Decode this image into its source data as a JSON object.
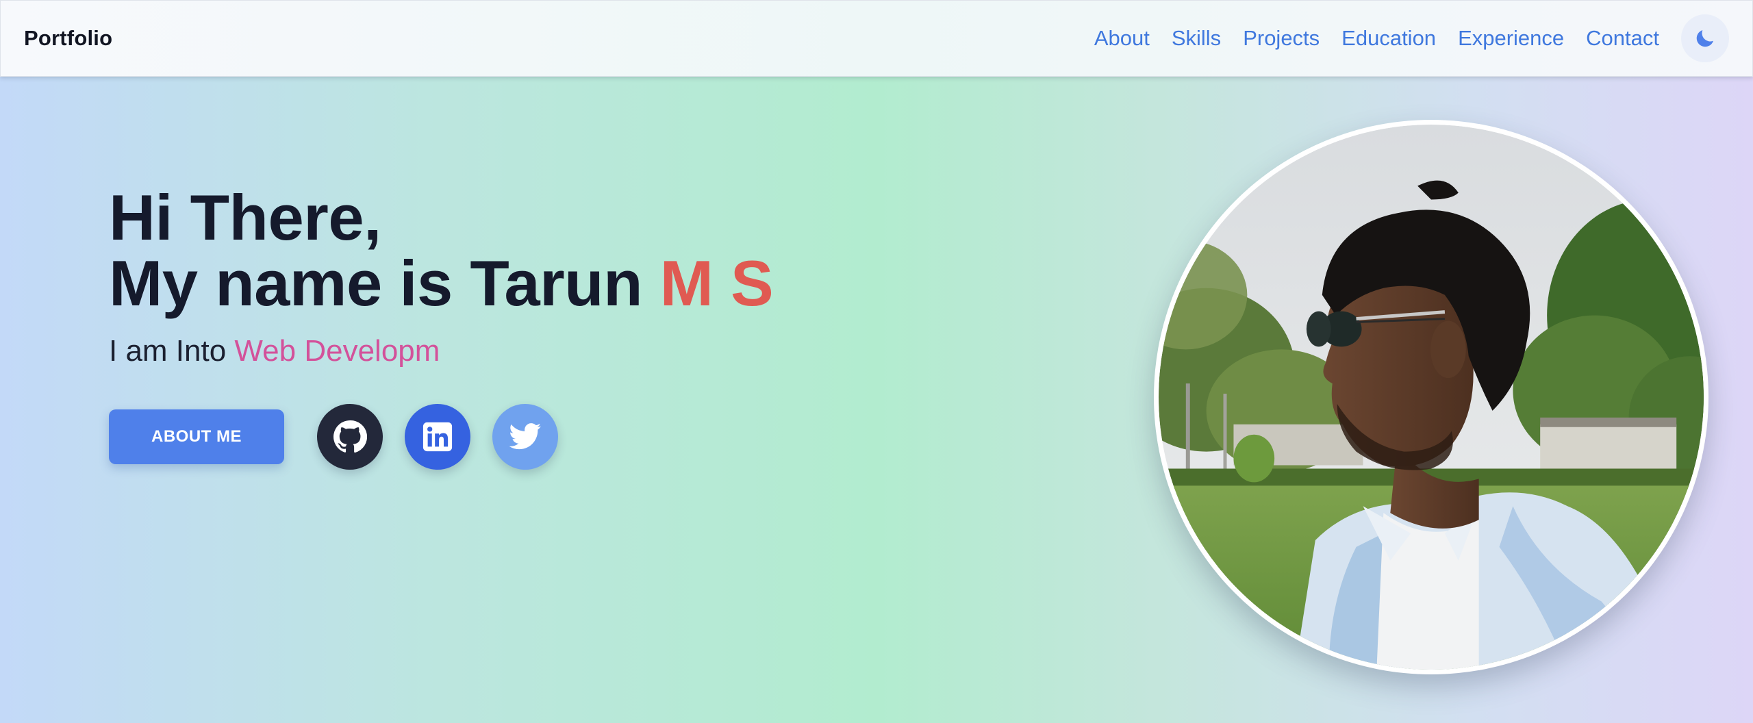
{
  "navbar": {
    "brand": "Portfolio",
    "links": [
      "About",
      "Skills",
      "Projects",
      "Education",
      "Experience",
      "Contact"
    ],
    "theme_toggle_icon": "moon-icon"
  },
  "hero": {
    "line1": "Hi There,",
    "line2_prefix": "My name is Tarun ",
    "line2_accent": "M S",
    "subtitle_prefix": "I am Into ",
    "subtitle_typed": "Web Developm",
    "about_button": "ABOUT ME",
    "socials": [
      {
        "name": "GitHub",
        "icon": "github-icon"
      },
      {
        "name": "LinkedIn",
        "icon": "linkedin-icon"
      },
      {
        "name": "Twitter",
        "icon": "twitter-icon"
      }
    ]
  },
  "colors": {
    "link": "#3f78de",
    "heading": "#151a2c",
    "name_accent": "#e05a52",
    "typed_accent": "#d3519a",
    "primary_button": "#4f80ea",
    "github": "#23283a",
    "linkedin": "#3562e0",
    "twitter": "#70a2ee"
  }
}
